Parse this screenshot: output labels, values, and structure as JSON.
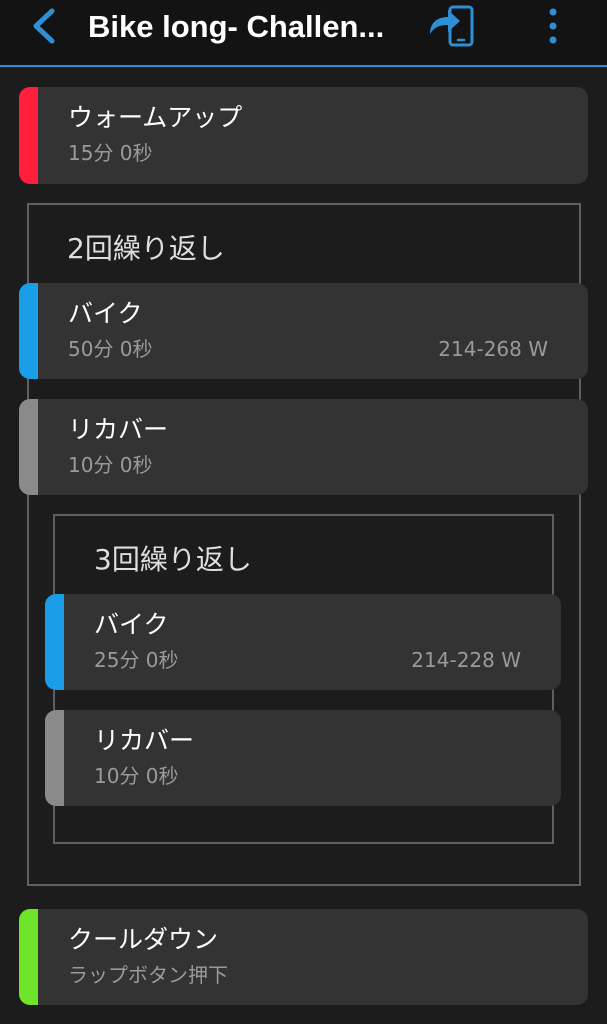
{
  "header": {
    "title": "Bike long- Challen...",
    "back_icon": "chevron-left-icon",
    "send_icon": "send-to-device-icon",
    "menu_icon": "more-vertical-icon",
    "accent_color": "#2f8fd6"
  },
  "colors": {
    "warmup": "#ff1f3d",
    "active": "#1a9ee8",
    "recovery": "#8a8a8a",
    "cooldown": "#6ee52a"
  },
  "workout": {
    "warmup": {
      "name": "ウォームアップ",
      "duration": "15分 0秒"
    },
    "repeat_outer": {
      "label": "2回繰り返し",
      "bike": {
        "name": "バイク",
        "duration": "50分 0秒",
        "target": "214-268 W"
      },
      "recovery": {
        "name": "リカバー",
        "duration": "10分 0秒"
      },
      "repeat_inner": {
        "label": "3回繰り返し",
        "bike": {
          "name": "バイク",
          "duration": "25分 0秒",
          "target": "214-228 W"
        },
        "recovery": {
          "name": "リカバー",
          "duration": "10分 0秒"
        }
      }
    },
    "cooldown": {
      "name": "クールダウン",
      "duration": "ラップボタン押下"
    }
  }
}
